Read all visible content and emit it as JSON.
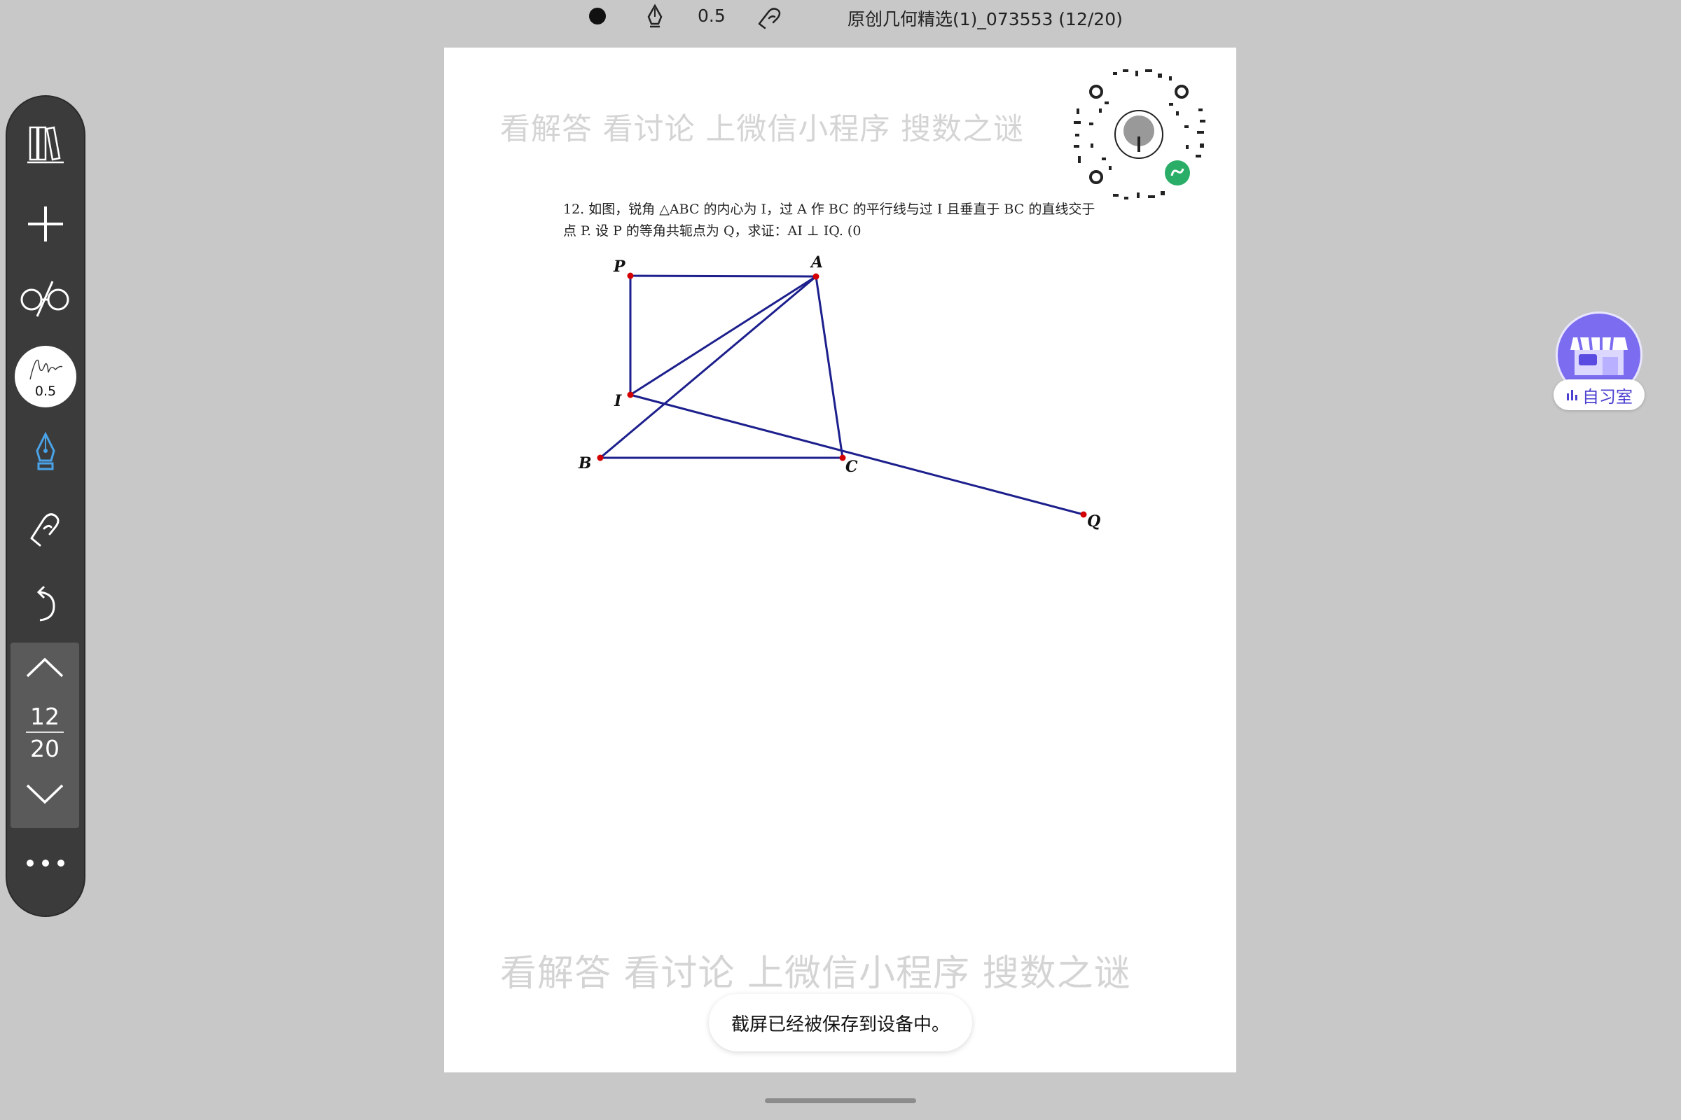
{
  "topbar": {
    "stroke_width": "0.5",
    "doc_title": "原创几何精选(1)_073553 (12/20)"
  },
  "toolbar": {
    "icons": [
      "library-icon",
      "plus-icon",
      "glasses-icon",
      "pen-preview",
      "fountain-pen-icon",
      "hand-icon",
      "undo-icon",
      "chevron-up-icon",
      "chevron-down-icon",
      "more-icon"
    ],
    "pen_size": "0.5",
    "current_page": "12",
    "total_pages": "20"
  },
  "page": {
    "watermark_top": "看解答 看讨论 上微信小程序 搜数之谜",
    "watermark_bottom": "看解答 看讨论 上微信小程序 搜数之谜",
    "problem_line1": "12.  如图，锐角 △ABC 的内心为 I，过 A 作 BC 的平行线与过 I 且垂直于 BC 的直线交于",
    "problem_line2": "点 P. 设 P 的等角共轭点为 Q，求证：AI ⊥ IQ. (0",
    "diagram": {
      "label_P": "P",
      "label_A": "A",
      "label_I": "I",
      "label_B": "B",
      "label_C": "C",
      "label_Q": "Q",
      "line_color": "#1c1f8c",
      "point_color": "#d40000"
    }
  },
  "toast": {
    "text": "截屏已经被保存到设备中。"
  },
  "study_room": {
    "label": "自习室",
    "badge": "自习"
  }
}
